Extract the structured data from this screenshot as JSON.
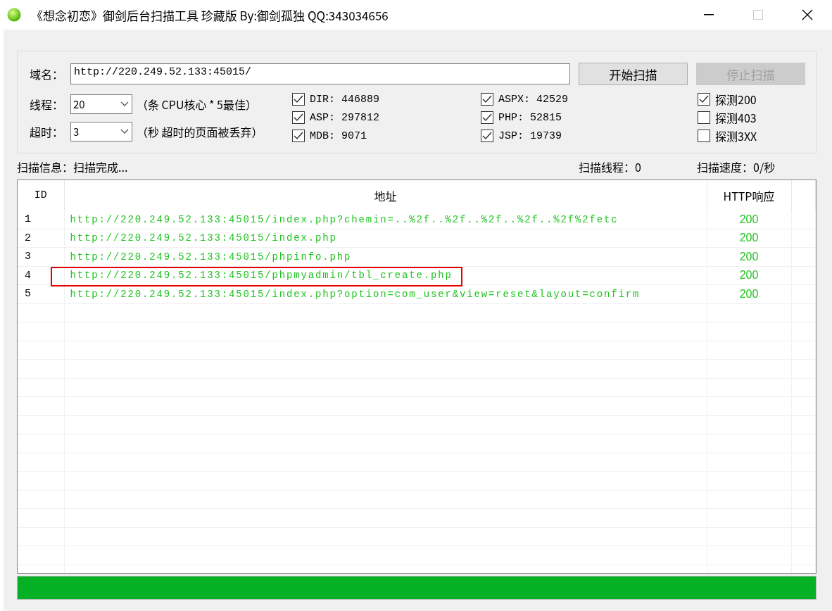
{
  "window": {
    "title": "《想念初恋》御剑后台扫描工具 珍藏版 By:御剑孤独 QQ:343034656"
  },
  "domain": {
    "label": "域名：",
    "value": "http://220.249.52.133:45015/"
  },
  "buttons": [
    {
      "label": "开始扫描",
      "disabled": false
    },
    {
      "label": "停止扫描",
      "disabled": true
    }
  ],
  "options": [
    {
      "label": "线程：",
      "value": "20",
      "hint": "（条 CPU核心 * 5最佳）"
    },
    {
      "label": "超时：",
      "value": "3",
      "hint": "（秒 超时的页面被丢弃）"
    }
  ],
  "dictionaries": [
    {
      "label": "DIR: 446889",
      "checked": true
    },
    {
      "label": "ASP: 297812",
      "checked": true
    },
    {
      "label": "MDB: 9071",
      "checked": true
    },
    {
      "label": "ASPX: 42529",
      "checked": true
    },
    {
      "label": "PHP: 52815",
      "checked": true
    },
    {
      "label": "JSP: 19739",
      "checked": true
    }
  ],
  "probes": [
    {
      "label": "探测200",
      "checked": true
    },
    {
      "label": "探测403",
      "checked": false
    },
    {
      "label": "探测3XX",
      "checked": false
    }
  ],
  "status": {
    "info": "扫描信息：扫描完成...",
    "threads": "扫描线程：0",
    "speed": "扫描速度：0/秒"
  },
  "table": {
    "columns": [
      "ID",
      "地址",
      "HTTP响应"
    ],
    "rows": [
      {
        "id": "1",
        "url": "http://220.249.52.133:45015/index.php?chemin=..%2f..%2f..%2f..%2f..%2f%2fetc",
        "code": "200",
        "highlighted": false
      },
      {
        "id": "2",
        "url": "http://220.249.52.133:45015/index.php",
        "code": "200",
        "highlighted": false
      },
      {
        "id": "3",
        "url": "http://220.249.52.133:45015/phpinfo.php",
        "code": "200",
        "highlighted": false
      },
      {
        "id": "4",
        "url": "http://220.249.52.133:45015/phpmyadmin/tbl_create.php",
        "code": "200",
        "highlighted": true
      },
      {
        "id": "5",
        "url": "http://220.249.52.133:45015/index.php?option=com_user&view=reset&layout=confirm",
        "code": "200",
        "highlighted": false
      }
    ]
  },
  "progress": {
    "level": 1
  }
}
